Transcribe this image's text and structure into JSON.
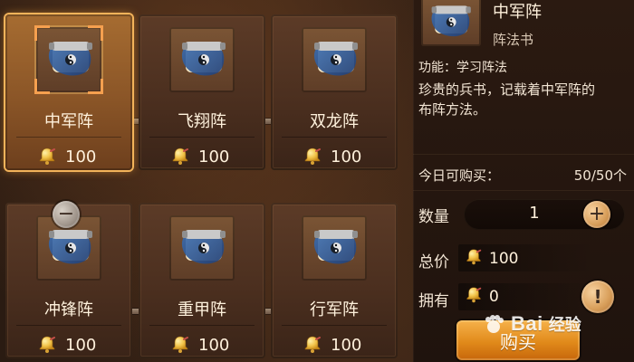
{
  "colors": {
    "accent_orange": "#f2b35a",
    "buy_orange": "#e18a1a",
    "text": "#fff1dc"
  },
  "shop": {
    "items": [
      {
        "name": "中军阵",
        "price": "100",
        "icon": "scroll-icon",
        "currency_icon": "bell-icon"
      },
      {
        "name": "飞翔阵",
        "price": "100",
        "icon": "scroll-icon",
        "currency_icon": "bell-icon"
      },
      {
        "name": "双龙阵",
        "price": "100",
        "icon": "scroll-icon",
        "currency_icon": "bell-icon"
      },
      {
        "name": "冲锋阵",
        "price": "100",
        "icon": "scroll-icon",
        "currency_icon": "bell-icon"
      },
      {
        "name": "重甲阵",
        "price": "100",
        "icon": "scroll-icon",
        "currency_icon": "bell-icon"
      },
      {
        "name": "行军阵",
        "price": "100",
        "icon": "scroll-icon",
        "currency_icon": "bell-icon"
      }
    ],
    "selected_name": "中军阵"
  },
  "details": {
    "title": "中军阵",
    "type": "阵法书",
    "function": "功能：学习阵法",
    "description": "珍贵的兵书，记载着中军阵的布阵方法。",
    "daily_limit_label": "今日可购买：",
    "daily_limit_value": "50/50个",
    "quantity_label": "数量",
    "quantity_value": "1",
    "minus_symbol": "−",
    "plus_symbol": "+",
    "total_label": "总价",
    "total_value": "100",
    "owned_label": "拥有",
    "owned_value": "0",
    "info_symbol": "!",
    "buy_label": "购买"
  },
  "watermark": {
    "text": "Bai",
    "sub": "经验",
    "icon": "paw-icon"
  }
}
